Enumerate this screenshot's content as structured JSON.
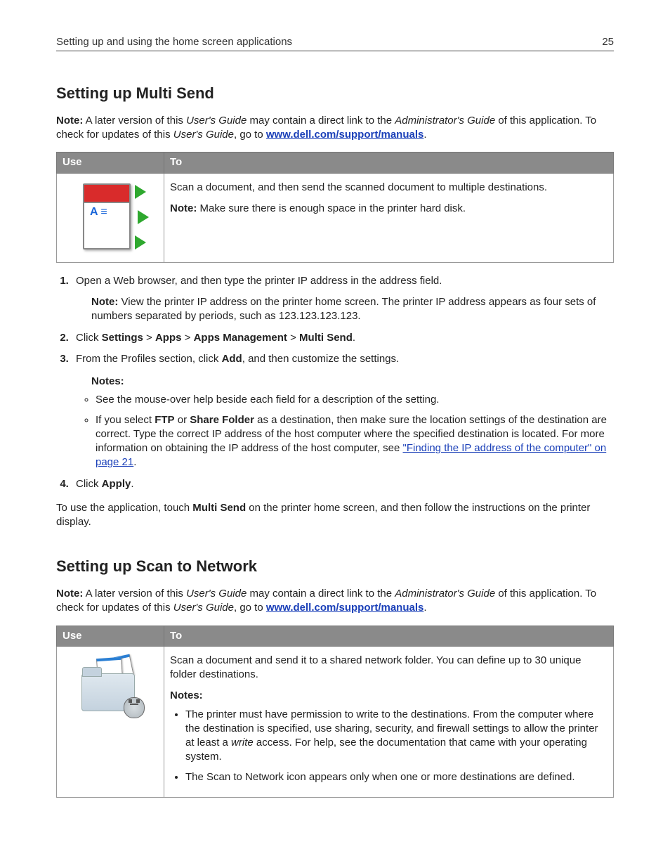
{
  "header": {
    "chapter": "Setting up and using the home screen applications",
    "page_num": "25"
  },
  "s1": {
    "heading": "Setting up Multi Send",
    "note_label": "Note:",
    "intro_a": " A later version of this ",
    "intro_ug": "User's Guide",
    "intro_b": " may contain a direct link to the ",
    "intro_ag": "Administrator's Guide",
    "intro_c": " of this application. To check for updates of this ",
    "intro_ug2": "User's Guide",
    "intro_d": ", go to ",
    "link": "www.dell.com/support/manuals",
    "period": ".",
    "table": {
      "h_use": "Use",
      "h_to": "To",
      "desc": "Scan a document, and then send the scanned document to multiple destinations.",
      "note_label": "Note:",
      "note_text": " Make sure there is enough space in the printer hard disk."
    },
    "step1": "Open a Web browser, and then type the printer IP address in the address field.",
    "step1_note_label": "Note:",
    "step1_note": " View the printer IP address on the printer home screen. The printer IP address appears as four sets of numbers separated by periods, such as 123.123.123.123.",
    "step2_a": "Click ",
    "step2_settings": "Settings",
    "step2_gt1": " > ",
    "step2_apps": "Apps",
    "step2_gt2": " > ",
    "step2_mgmt": "Apps Management",
    "step2_gt3": " > ",
    "step2_ms": "Multi Send",
    "step2_end": ".",
    "step3_a": "From the Profiles section, click ",
    "step3_add": "Add",
    "step3_b": ", and then customize the settings.",
    "notes_heading": "Notes:",
    "bullet1": "See the mouse‑over help beside each field for a description of the setting.",
    "bullet2_a": "If you select ",
    "bullet2_ftp": "FTP",
    "bullet2_b": " or ",
    "bullet2_sf": "Share Folder",
    "bullet2_c": " as a destination, then make sure the location settings of the destination are correct. Type the correct IP address of the host computer where the specified destination is located. For more information on obtaining the IP address of the host computer, see ",
    "bullet2_link": "\"Finding the IP address of the computer\" on page 21",
    "bullet2_end": ".",
    "step4_a": "Click ",
    "step4_apply": "Apply",
    "step4_end": ".",
    "outro_a": "To use the application, touch ",
    "outro_ms": "Multi Send",
    "outro_b": " on the printer home screen, and then follow the instructions on the printer display."
  },
  "s2": {
    "heading": "Setting up Scan to Network",
    "note_label": "Note:",
    "intro_a": " A later version of this ",
    "intro_ug": "User's Guide",
    "intro_b": " may contain a direct link to the ",
    "intro_ag": "Administrator's Guide",
    "intro_c": " of this application. To check for updates of this ",
    "intro_ug2": "User's Guide",
    "intro_d": ", go to ",
    "link": "www.dell.com/support/manuals",
    "period": ".",
    "table": {
      "h_use": "Use",
      "h_to": "To",
      "desc": "Scan a document and send it to a shared network folder. You can define up to 30 unique folder destinations.",
      "notes_heading": "Notes:",
      "b1_a": "The printer must have permission to write to the destinations. From the computer where the destination is specified, use sharing, security, and firewall settings to allow the printer at least a ",
      "b1_write": "write",
      "b1_b": " access. For help, see the documentation that came with your operating system.",
      "b2": "The Scan to Network icon appears only when one or more destinations are defined."
    }
  }
}
